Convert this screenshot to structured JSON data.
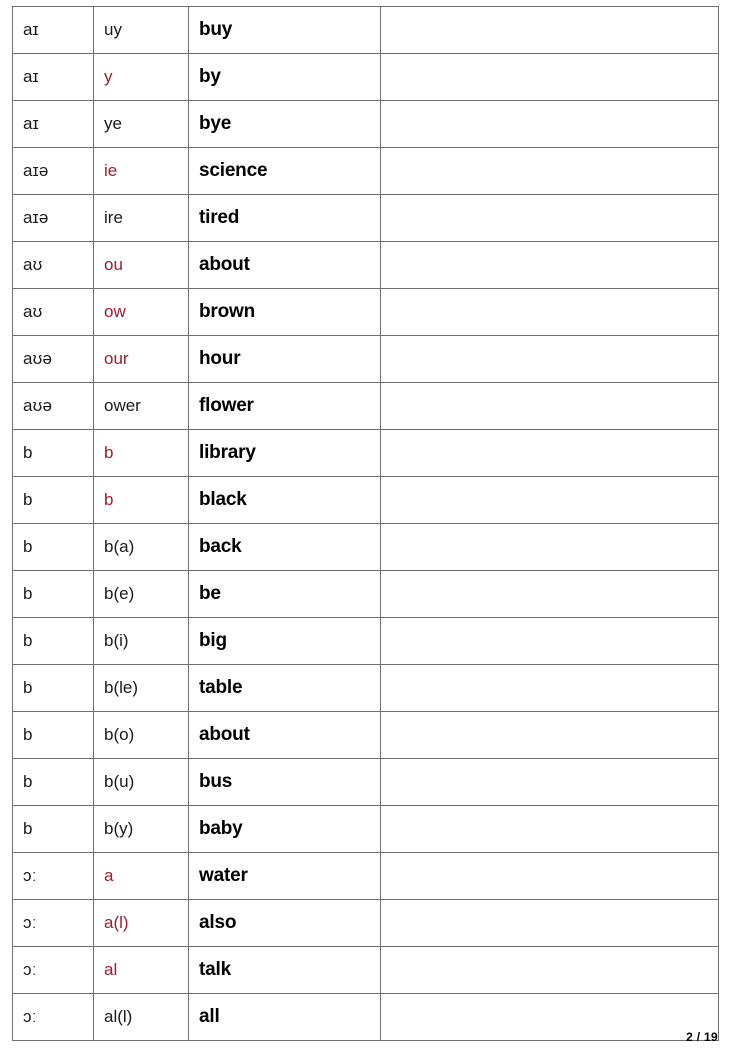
{
  "page": {
    "footer_label": "2 / 19",
    "accent_red": "#9d1c33",
    "text_black": "#1a1a1a",
    "border_color": "#6f6f6f"
  },
  "table": {
    "columns": [
      "ipa",
      "spelling",
      "word",
      "notes"
    ],
    "rows": [
      {
        "ipa": "aɪ",
        "spelling": "uy",
        "spelling_red": false,
        "word": "buy",
        "notes": ""
      },
      {
        "ipa": "aɪ",
        "spelling": "y",
        "spelling_red": true,
        "word": "by",
        "notes": ""
      },
      {
        "ipa": "aɪ",
        "spelling": "ye",
        "spelling_red": false,
        "word": "bye",
        "notes": ""
      },
      {
        "ipa": "aɪə",
        "spelling": "ie",
        "spelling_red": true,
        "word": "science",
        "notes": ""
      },
      {
        "ipa": "aɪə",
        "spelling": "ire",
        "spelling_red": false,
        "word": "tired",
        "notes": ""
      },
      {
        "ipa": "aʊ",
        "spelling": "ou",
        "spelling_red": true,
        "word": "about",
        "notes": ""
      },
      {
        "ipa": "aʊ",
        "spelling": "ow",
        "spelling_red": true,
        "word": "brown",
        "notes": ""
      },
      {
        "ipa": "aʊə",
        "spelling": "our",
        "spelling_red": true,
        "word": "hour",
        "notes": ""
      },
      {
        "ipa": "aʊə",
        "spelling": "ower",
        "spelling_red": false,
        "word": "flower",
        "notes": ""
      },
      {
        "ipa": "b",
        "spelling": "b",
        "spelling_red": true,
        "word": "library",
        "notes": ""
      },
      {
        "ipa": "b",
        "spelling": "b",
        "spelling_red": true,
        "word": "black",
        "notes": ""
      },
      {
        "ipa": "b",
        "spelling": "b(a)",
        "spelling_red": false,
        "word": "back",
        "notes": ""
      },
      {
        "ipa": "b",
        "spelling": "b(e)",
        "spelling_red": false,
        "word": "be",
        "notes": ""
      },
      {
        "ipa": "b",
        "spelling": "b(i)",
        "spelling_red": false,
        "word": "big",
        "notes": ""
      },
      {
        "ipa": "b",
        "spelling": "b(le)",
        "spelling_red": false,
        "word": "table",
        "notes": ""
      },
      {
        "ipa": "b",
        "spelling": "b(o)",
        "spelling_red": false,
        "word": "about",
        "notes": ""
      },
      {
        "ipa": "b",
        "spelling": "b(u)",
        "spelling_red": false,
        "word": "bus",
        "notes": ""
      },
      {
        "ipa": "b",
        "spelling": "b(y)",
        "spelling_red": false,
        "word": "baby",
        "notes": ""
      },
      {
        "ipa": "ɔː",
        "spelling": "a",
        "spelling_red": true,
        "word": "water",
        "notes": ""
      },
      {
        "ipa": "ɔː",
        "spelling": "a(l)",
        "spelling_red": true,
        "word": "also",
        "notes": ""
      },
      {
        "ipa": "ɔː",
        "spelling": "al",
        "spelling_red": true,
        "word": "talk",
        "notes": ""
      },
      {
        "ipa": "ɔː",
        "spelling": "al(l)",
        "spelling_red": false,
        "word": "all",
        "notes": ""
      }
    ]
  }
}
